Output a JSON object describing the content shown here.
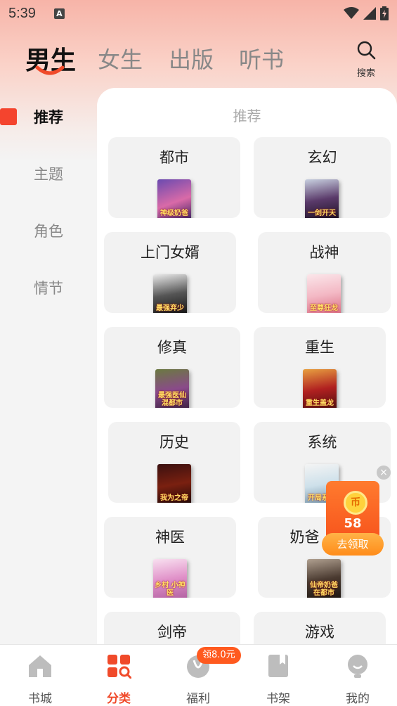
{
  "status_bar": {
    "time": "5:39",
    "notification_letter": "A"
  },
  "tabs": [
    {
      "label": "男生",
      "active": true
    },
    {
      "label": "女生",
      "active": false
    },
    {
      "label": "出版",
      "active": false
    },
    {
      "label": "听书",
      "active": false
    }
  ],
  "search": {
    "label": "搜索",
    "icon": "search-icon"
  },
  "sidebar": {
    "items": [
      {
        "label": "推荐",
        "active": true
      },
      {
        "label": "主题",
        "active": false
      },
      {
        "label": "角色",
        "active": false
      },
      {
        "label": "情节",
        "active": false
      }
    ]
  },
  "content": {
    "title": "推荐",
    "categories": [
      {
        "label": "都市",
        "cover_text": "神级奶爸"
      },
      {
        "label": "玄幻",
        "cover_text": "一剑开天"
      },
      {
        "label": "上门女婿",
        "cover_text": "最强弃少"
      },
      {
        "label": "战神",
        "cover_text": "至尊狂龙"
      },
      {
        "label": "修真",
        "cover_text": "最强医仙 混都市"
      },
      {
        "label": "重生",
        "cover_text": "重生盖龙"
      },
      {
        "label": "历史",
        "cover_text": "我为之帝"
      },
      {
        "label": "系统",
        "cover_text": "开局系统"
      },
      {
        "label": "神医",
        "cover_text": "乡村 小神医"
      },
      {
        "label": "奶爸",
        "cover_text": "仙帝奶爸 在都市"
      },
      {
        "label": "剑帝",
        "cover_text": ""
      },
      {
        "label": "游戏",
        "cover_text": ""
      }
    ]
  },
  "reward_widget": {
    "coin_symbol": "币",
    "amount": "58",
    "button_label": "去领取",
    "close_symbol": "×"
  },
  "bottom_nav": {
    "badge": "领8.0元",
    "items": [
      {
        "label": "书城",
        "icon": "home-icon",
        "active": false
      },
      {
        "label": "分类",
        "icon": "category-icon",
        "active": true
      },
      {
        "label": "福利",
        "icon": "gift-icon",
        "active": false
      },
      {
        "label": "书架",
        "icon": "bookshelf-icon",
        "active": false
      },
      {
        "label": "我的",
        "icon": "profile-icon",
        "active": false
      }
    ]
  },
  "colors": {
    "accent": "#f04a2a",
    "active_marker": "#f4442e",
    "reward_orange": "#ff7b2e"
  }
}
